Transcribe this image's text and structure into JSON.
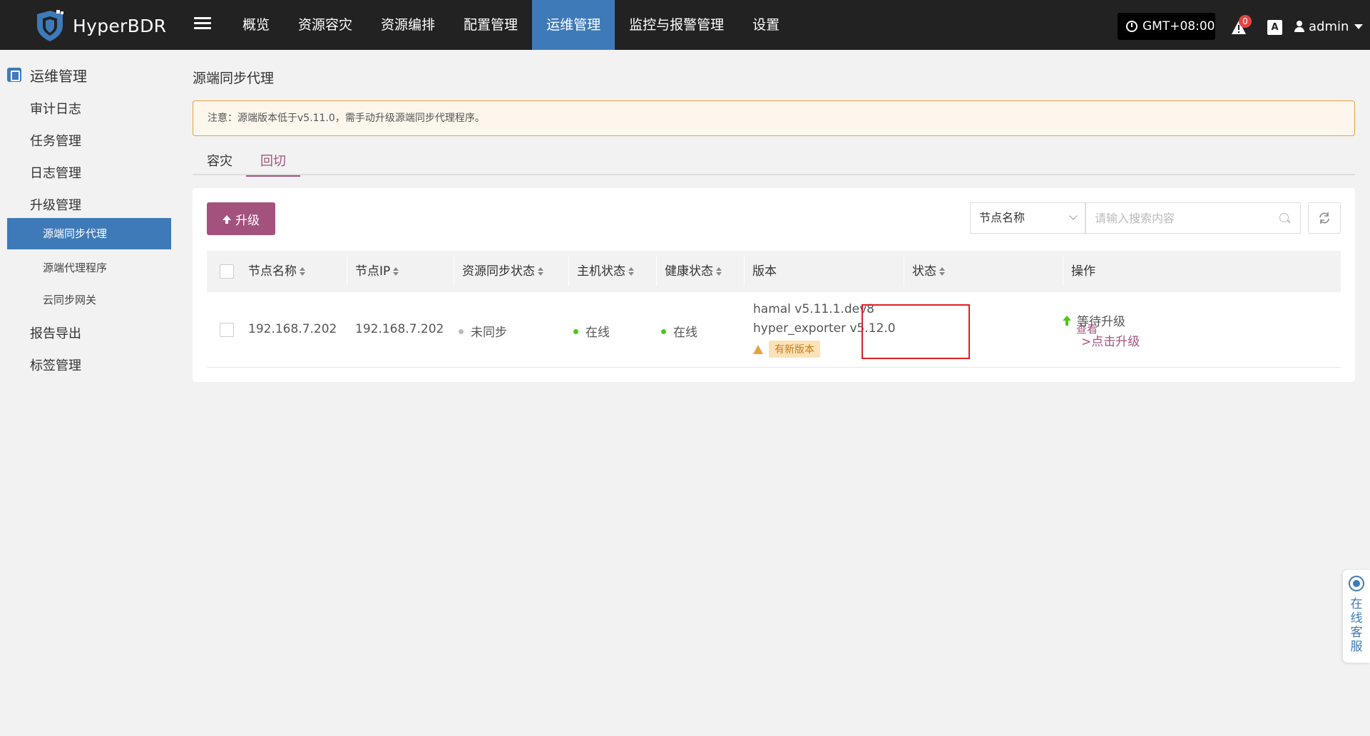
{
  "app": {
    "name": "HyperBDR"
  },
  "topnav": {
    "items": [
      "概览",
      "资源容灾",
      "资源编排",
      "配置管理",
      "运维管理",
      "监控与报警管理",
      "设置"
    ],
    "active_index": 4
  },
  "header": {
    "timezone": "GMT+08:00",
    "alert_count": "0",
    "lang_icon": "A",
    "user": "admin"
  },
  "sidebar": {
    "title": "运维管理",
    "items": [
      "审计日志",
      "任务管理",
      "日志管理",
      "升级管理"
    ],
    "sub_items": [
      "源端同步代理",
      "源端代理程序",
      "云同步网关"
    ],
    "active_sub": "源端同步代理",
    "bottom_items": [
      "报告导出",
      "标签管理"
    ]
  },
  "page": {
    "title": "源端同步代理",
    "notice": "注意：源端版本低于v5.11.0，需手动升级源端同步代理程序。"
  },
  "tabs": [
    "容灾",
    "回切"
  ],
  "active_tab": "回切",
  "toolbar": {
    "upgrade_label": "升级",
    "search_field": "节点名称",
    "search_placeholder": "请输入搜索内容"
  },
  "table": {
    "columns": [
      "节点名称",
      "节点IP",
      "资源同步状态",
      "主机状态",
      "健康状态",
      "版本",
      "状态",
      "操作"
    ],
    "rows": [
      {
        "node_name": "192.168.7.202",
        "node_ip": "192.168.7.202",
        "sync_status": "未同步",
        "host_status": "在线",
        "health_status": "在线",
        "version_line1": "hamal v5.11.1.dev8",
        "version_line2": "hyper_exporter v5.12.0",
        "version_badge": "有新版本",
        "status": "等待升级",
        "status_action": ">点击升级",
        "operation": "查看"
      }
    ]
  },
  "service": {
    "label": "在线客服"
  },
  "colors": {
    "topbar": "#222222",
    "accent_blue": "#3f7ab8",
    "accent_plum": "#a3527e",
    "online_green": "#52c41a",
    "warning_orange": "#e6a23c",
    "highlight_red": "#e02020"
  }
}
